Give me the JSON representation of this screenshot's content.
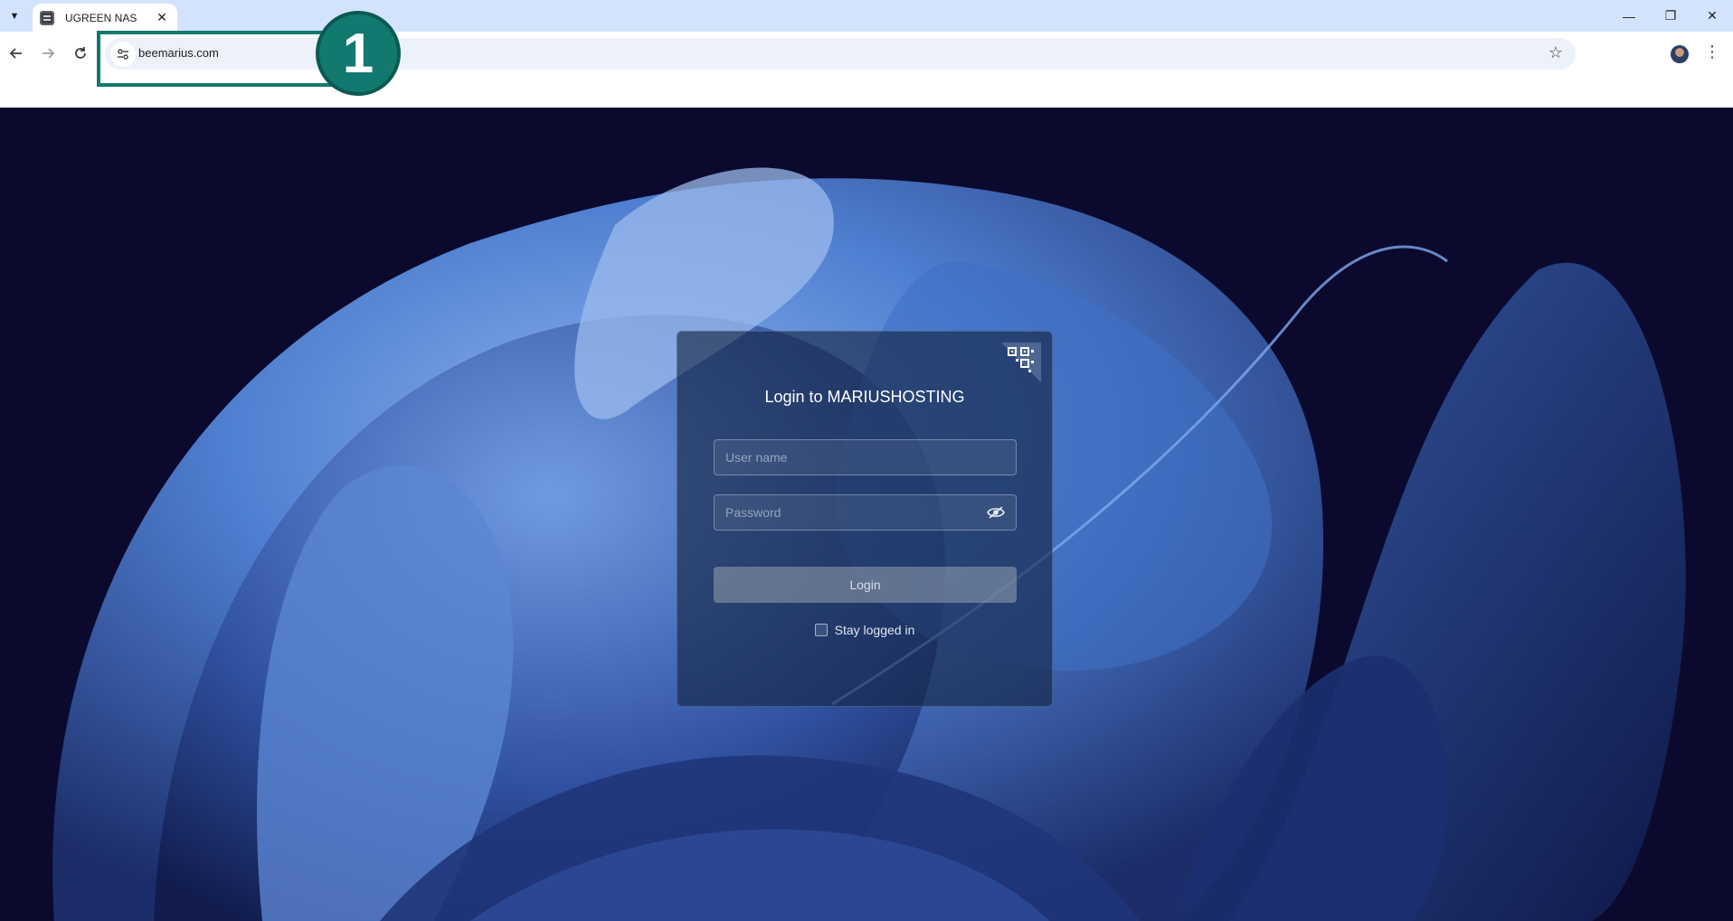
{
  "browser": {
    "tab": {
      "title": "UGREEN NAS",
      "close_symbol": "✕"
    },
    "window_controls": {
      "minimize": "—",
      "restore": "❐",
      "close": "✕"
    },
    "address_bar": {
      "url": "beemarius.com"
    }
  },
  "annotation": {
    "step_number": "1",
    "color": "#12796f"
  },
  "login": {
    "title": "Login to MARIUSHOSTING",
    "username_placeholder": "User name",
    "password_placeholder": "Password",
    "login_button": "Login",
    "stay_logged_in_label": "Stay logged in",
    "stay_logged_in_checked": false
  },
  "colors": {
    "tabstrip": "#d3e3fd",
    "omnibox": "#edf2fa",
    "background": "#0b0a2e",
    "wallpaper_accent": "#4f7fd0"
  }
}
